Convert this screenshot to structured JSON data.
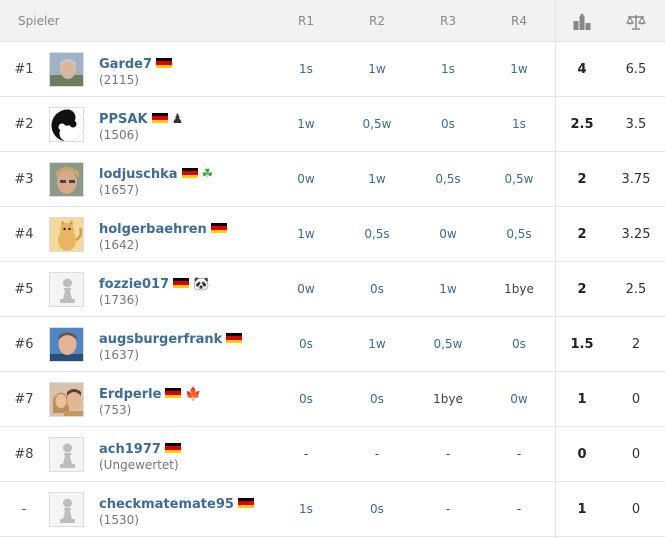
{
  "header": {
    "player_label": "Spieler",
    "rounds": [
      "R1",
      "R2",
      "R3",
      "R4"
    ],
    "points_icon": "podium-icon",
    "tiebreak_icon": "scales-icon"
  },
  "colors": {
    "link": "#3d6b9a",
    "header_bg": "#f2f2f2",
    "flag_de": [
      "#000000",
      "#dd0000",
      "#ffce00"
    ]
  },
  "rows": [
    {
      "rank": "#1",
      "name": "Garde7",
      "rating": "(2115)",
      "badge": "",
      "badge_icon": "",
      "avatar": "photo-grey-beard",
      "results": [
        "1s",
        "1w",
        "1s",
        "1w"
      ],
      "points": "4",
      "tiebreak": "6.5"
    },
    {
      "rank": "#2",
      "name": "PPSAK",
      "rating": "(1506)",
      "badge": "♟",
      "badge_icon": "pawn-icon",
      "avatar": "yin-yang",
      "results": [
        "1w",
        "0,5w",
        "0s",
        "1s"
      ],
      "points": "2.5",
      "tiebreak": "3.5"
    },
    {
      "rank": "#3",
      "name": "lodjuschka",
      "rating": "(1657)",
      "badge": "☘",
      "badge_icon": "shamrock-icon",
      "avatar": "photo-blond",
      "results": [
        "0w",
        "1w",
        "0,5s",
        "0,5w"
      ],
      "points": "2",
      "tiebreak": "3.75"
    },
    {
      "rank": "#4",
      "name": "holgerbaehren",
      "rating": "(1642)",
      "badge": "",
      "badge_icon": "",
      "avatar": "cartoon-cat",
      "results": [
        "1w",
        "0,5s",
        "0w",
        "0,5s"
      ],
      "points": "2",
      "tiebreak": "3.25"
    },
    {
      "rank": "#5",
      "name": "fozzie017",
      "rating": "(1736)",
      "badge": "🐼",
      "badge_icon": "panda-icon",
      "avatar": "default-pawn",
      "results": [
        "0w",
        "0s",
        "1w",
        "1bye"
      ],
      "points": "2",
      "tiebreak": "2.5"
    },
    {
      "rank": "#6",
      "name": "augsburgerfrank",
      "rating": "(1637)",
      "badge": "",
      "badge_icon": "",
      "avatar": "photo-man",
      "results": [
        "0s",
        "1w",
        "0,5w",
        "0s"
      ],
      "points": "1.5",
      "tiebreak": "2"
    },
    {
      "rank": "#7",
      "name": "Erdperle",
      "rating": "(753)",
      "badge": "🍁",
      "badge_icon": "maple-leaf-icon",
      "avatar": "photo-couple",
      "results": [
        "0s",
        "0s",
        "1bye",
        "0w"
      ],
      "points": "1",
      "tiebreak": "0"
    },
    {
      "rank": "#8",
      "name": "ach1977",
      "rating": "(Ungewertet)",
      "badge": "",
      "badge_icon": "",
      "avatar": "default-pawn",
      "results": [
        "-",
        "-",
        "-",
        "-"
      ],
      "points": "0",
      "tiebreak": "0"
    },
    {
      "rank": "-",
      "name": "checkmatemate95",
      "rating": "(1530)",
      "badge": "",
      "badge_icon": "",
      "avatar": "default-pawn",
      "results": [
        "1s",
        "0s",
        "-",
        "-"
      ],
      "points": "1",
      "tiebreak": "0"
    }
  ]
}
